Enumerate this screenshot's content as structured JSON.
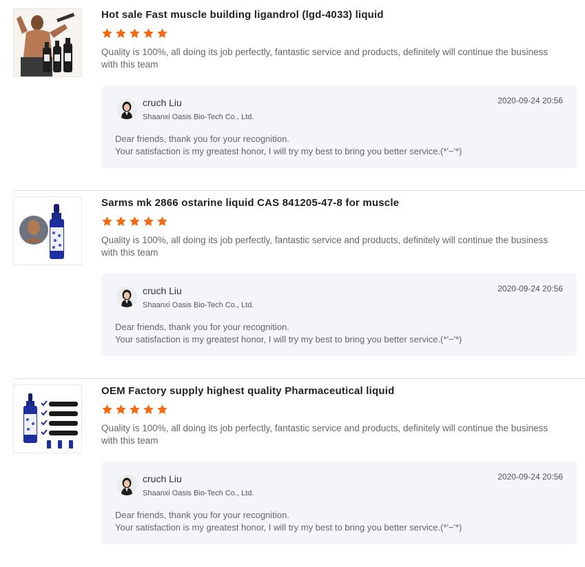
{
  "colors": {
    "star": "#f36a12",
    "reply_bg": "#f4f5f8",
    "divider": "#dcdcdc"
  },
  "reviews": [
    {
      "product_title": "Hot sale Fast muscle building ligandrol (lgd-4033) liquid",
      "rating": 5,
      "comment": "Quality is 100%, all doing its job perfectly, fantastic service and products, definitely will continue the business with this team",
      "reply": {
        "name": "cruch Liu",
        "company": "Shaanxi Oasis Bio-Tech Co., Ltd.",
        "time": "2020-09-24 20:56",
        "line1": "Dear friends, thank you for your recognition.",
        "line2": "Your satisfaction is my greatest honor, I will try my best to bring you better service.(*'−'*)"
      }
    },
    {
      "product_title": "Sarms mk 2866 ostarine liquid CAS 841205-47-8 for muscle",
      "rating": 5,
      "comment": "Quality is 100%, all doing its job perfectly, fantastic service and products, definitely will continue the business with this team",
      "reply": {
        "name": "cruch Liu",
        "company": "Shaanxi Oasis Bio-Tech Co., Ltd.",
        "time": "2020-09-24 20:56",
        "line1": "Dear friends, thank you for your recognition.",
        "line2": "Your satisfaction is my greatest honor, I will try my best to bring you better service.(*'−'*)"
      }
    },
    {
      "product_title": "OEM Factory supply highest quality Pharmaceutical liquid",
      "rating": 5,
      "comment": "Quality is 100%, all doing its job perfectly, fantastic service and products, definitely will continue the business with this team",
      "reply": {
        "name": "cruch Liu",
        "company": "Shaanxi Oasis Bio-Tech Co., Ltd.",
        "time": "2020-09-24 20:56",
        "line1": "Dear friends, thank you for your recognition.",
        "line2": "Your satisfaction is my greatest honor, I will try my best to bring you better service.(*'−'*)"
      }
    }
  ]
}
